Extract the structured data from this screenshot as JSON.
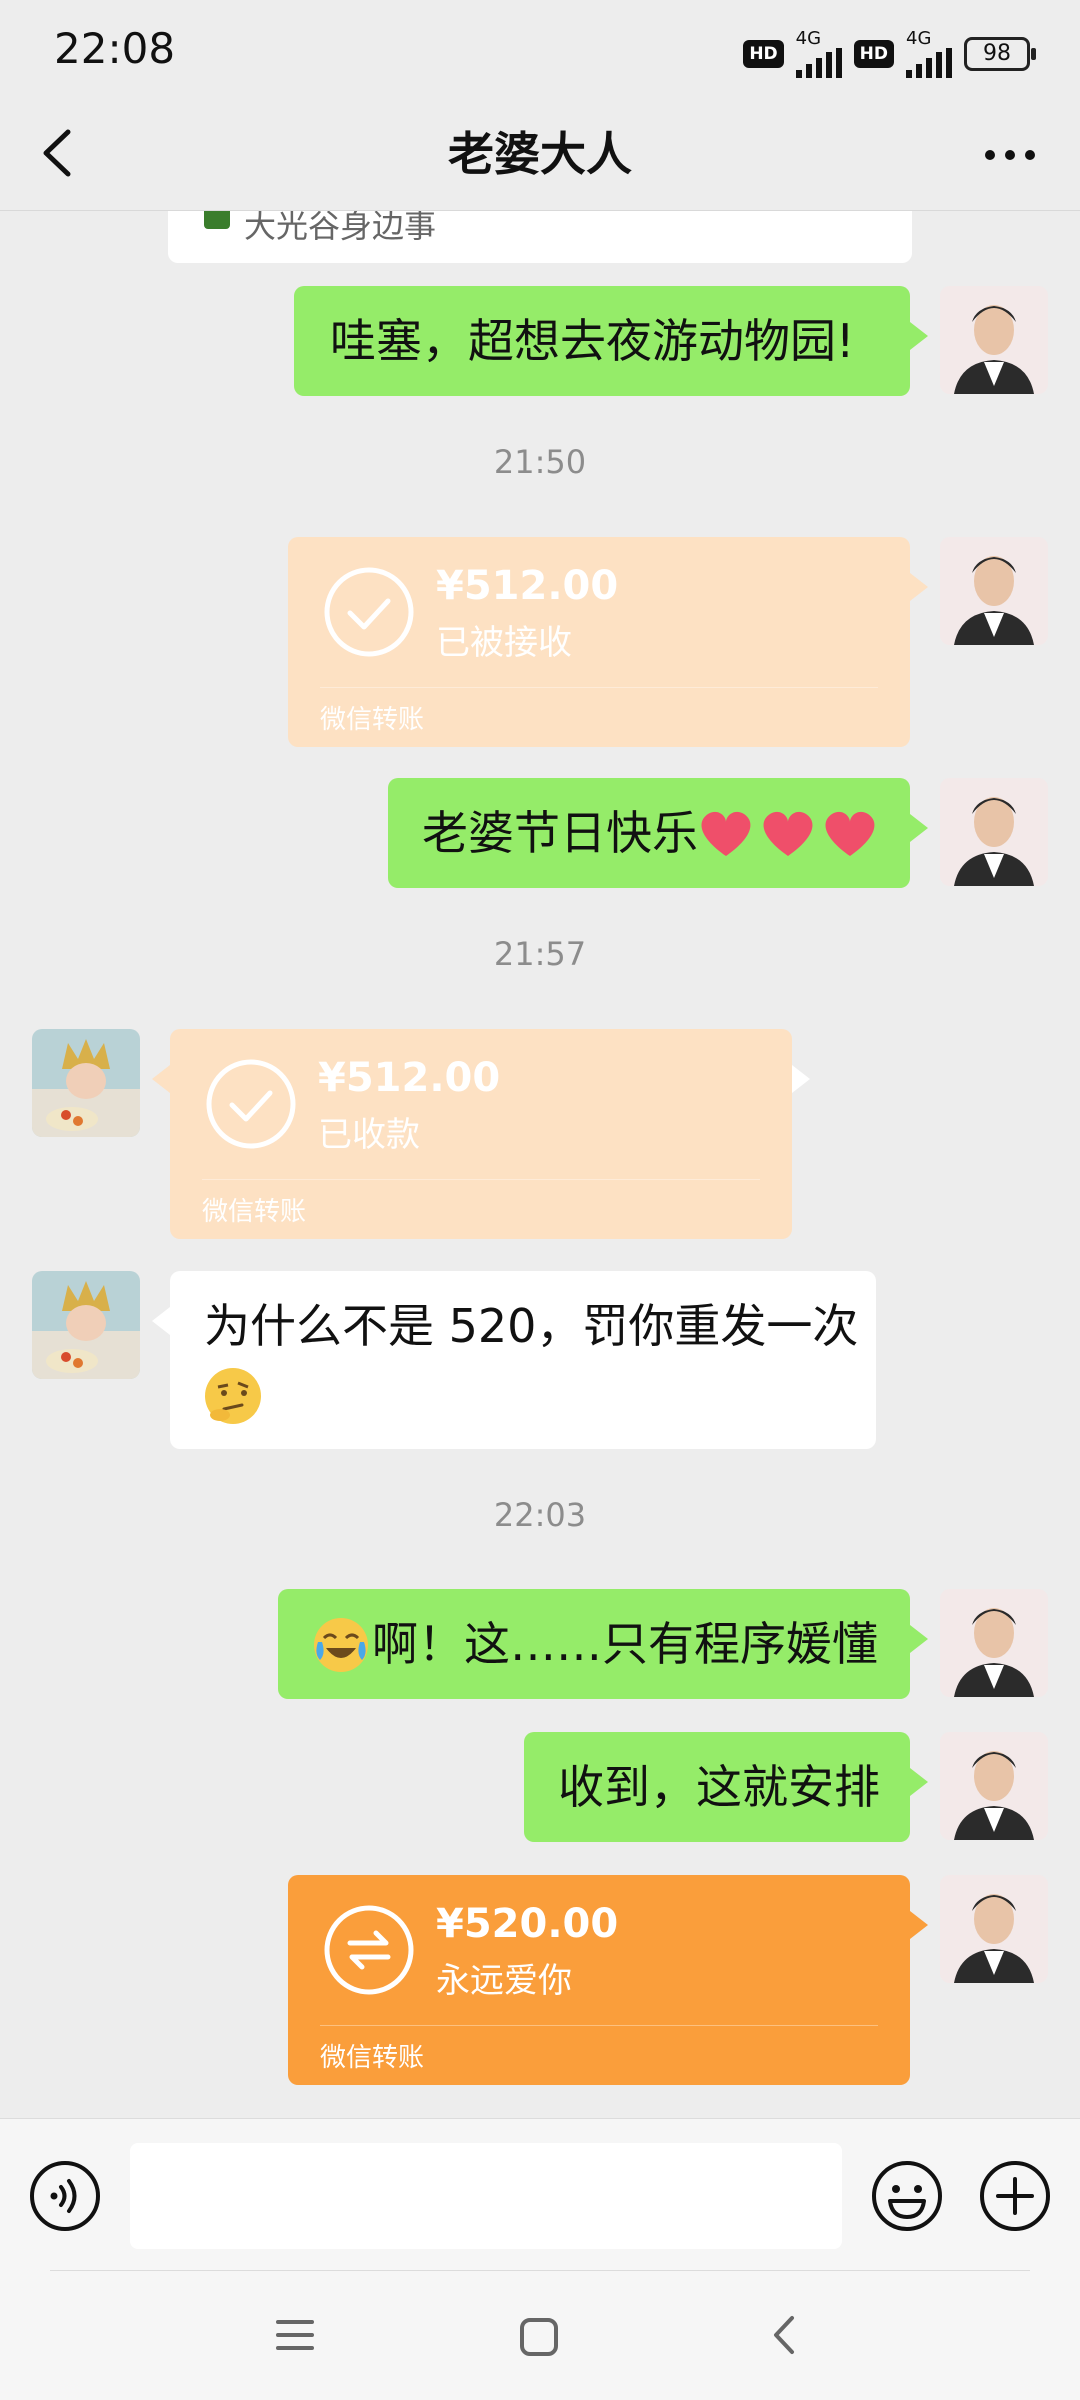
{
  "status": {
    "time": "22:08",
    "hd1": "HD",
    "net1": "4G",
    "hd2": "HD",
    "net2": "4G",
    "battery": "98"
  },
  "header": {
    "title": "老婆大人"
  },
  "top_card": {
    "text": "大光谷身边事"
  },
  "messages": {
    "m1": "哇塞，超想去夜游动物园!",
    "ts1": "21:50",
    "t1": {
      "amount": "¥512.00",
      "status": "已被接收",
      "footer": "微信转账"
    },
    "m2": "老婆节日快乐",
    "ts2": "21:57",
    "t2": {
      "amount": "¥512.00",
      "status": "已收款",
      "footer": "微信转账"
    },
    "m3": "为什么不是 520，罚你重发一次",
    "ts3": "22:03",
    "m4": "啊！这……只有程序媛懂",
    "m5": "收到，这就安排",
    "t3": {
      "amount": "¥520.00",
      "status": "永远爱你",
      "footer": "微信转账"
    }
  },
  "icons": [
    "back-icon",
    "more-icon",
    "voice-icon",
    "emoji-icon",
    "plus-icon",
    "heart-icon",
    "thinking-emoji",
    "laugh-cry-emoji"
  ],
  "colors": {
    "me_bubble": "#95ec69",
    "transfer_active": "#fa9e3b",
    "transfer_done": "#fde1c3"
  }
}
